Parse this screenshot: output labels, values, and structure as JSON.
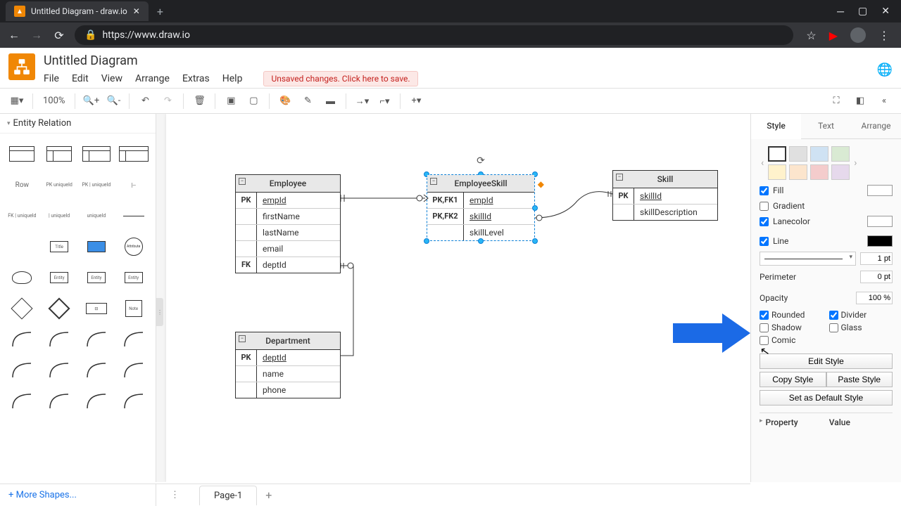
{
  "browser": {
    "tab_title": "Untitled Diagram - draw.io",
    "url": "https://www.draw.io"
  },
  "app": {
    "doc_title": "Untitled Diagram",
    "menus": [
      "File",
      "Edit",
      "View",
      "Arrange",
      "Extras",
      "Help"
    ],
    "unsaved_msg": "Unsaved changes. Click here to save."
  },
  "toolbar": {
    "zoom": "100%"
  },
  "sidebar": {
    "section": "Entity Relation",
    "row_label": "Row",
    "more_shapes": "More Shapes..."
  },
  "entities": {
    "employee": {
      "title": "Employee",
      "rows": [
        {
          "key": "PK",
          "attr": "empId",
          "pk": true
        },
        {
          "key": "",
          "attr": "firstName"
        },
        {
          "key": "",
          "attr": "lastName"
        },
        {
          "key": "",
          "attr": "email"
        },
        {
          "key": "FK",
          "attr": "deptId"
        }
      ]
    },
    "employeeskill": {
      "title": "EmployeeSkill",
      "rows": [
        {
          "key": "PK,FK1",
          "attr": "empId",
          "pk": true
        },
        {
          "key": "PK,FK2",
          "attr": "skillId",
          "pk": true
        },
        {
          "key": "",
          "attr": "skillLevel"
        }
      ]
    },
    "skill": {
      "title": "Skill",
      "rows": [
        {
          "key": "PK",
          "attr": "skillId",
          "pk": true
        },
        {
          "key": "",
          "attr": "skillDescription"
        }
      ]
    },
    "department": {
      "title": "Department",
      "rows": [
        {
          "key": "PK",
          "attr": "deptId",
          "pk": true
        },
        {
          "key": "",
          "attr": "name"
        },
        {
          "key": "",
          "attr": "phone"
        }
      ]
    }
  },
  "panel": {
    "tabs": [
      "Style",
      "Text",
      "Arrange"
    ],
    "active_tab": 0,
    "swatches1": [
      "#ffffff",
      "#e0e0e0",
      "#cfe2f3",
      "#d9ead3"
    ],
    "swatches2": [
      "#fff2cc",
      "#fce5cd",
      "#f4cccc",
      "#e6d9ec"
    ],
    "fill_label": "Fill",
    "fill_checked": true,
    "fill_color": "#ffffff",
    "gradient_label": "Gradient",
    "gradient_checked": false,
    "lanecolor_label": "Lanecolor",
    "lanecolor_checked": true,
    "lanecolor_color": "#ffffff",
    "line_label": "Line",
    "line_checked": true,
    "line_color": "#000000",
    "line_width": "1 pt",
    "perimeter_label": "Perimeter",
    "perimeter_val": "0 pt",
    "opacity_label": "Opacity",
    "opacity_val": "100 %",
    "rounded_label": "Rounded",
    "rounded_checked": true,
    "divider_label": "Divider",
    "divider_checked": true,
    "shadow_label": "Shadow",
    "shadow_checked": false,
    "glass_label": "Glass",
    "glass_checked": false,
    "comic_label": "Comic",
    "comic_checked": false,
    "edit_style": "Edit Style",
    "copy_style": "Copy Style",
    "paste_style": "Paste Style",
    "set_default": "Set as Default Style",
    "property_col": "Property",
    "value_col": "Value"
  },
  "footer": {
    "page_name": "Page-1"
  }
}
